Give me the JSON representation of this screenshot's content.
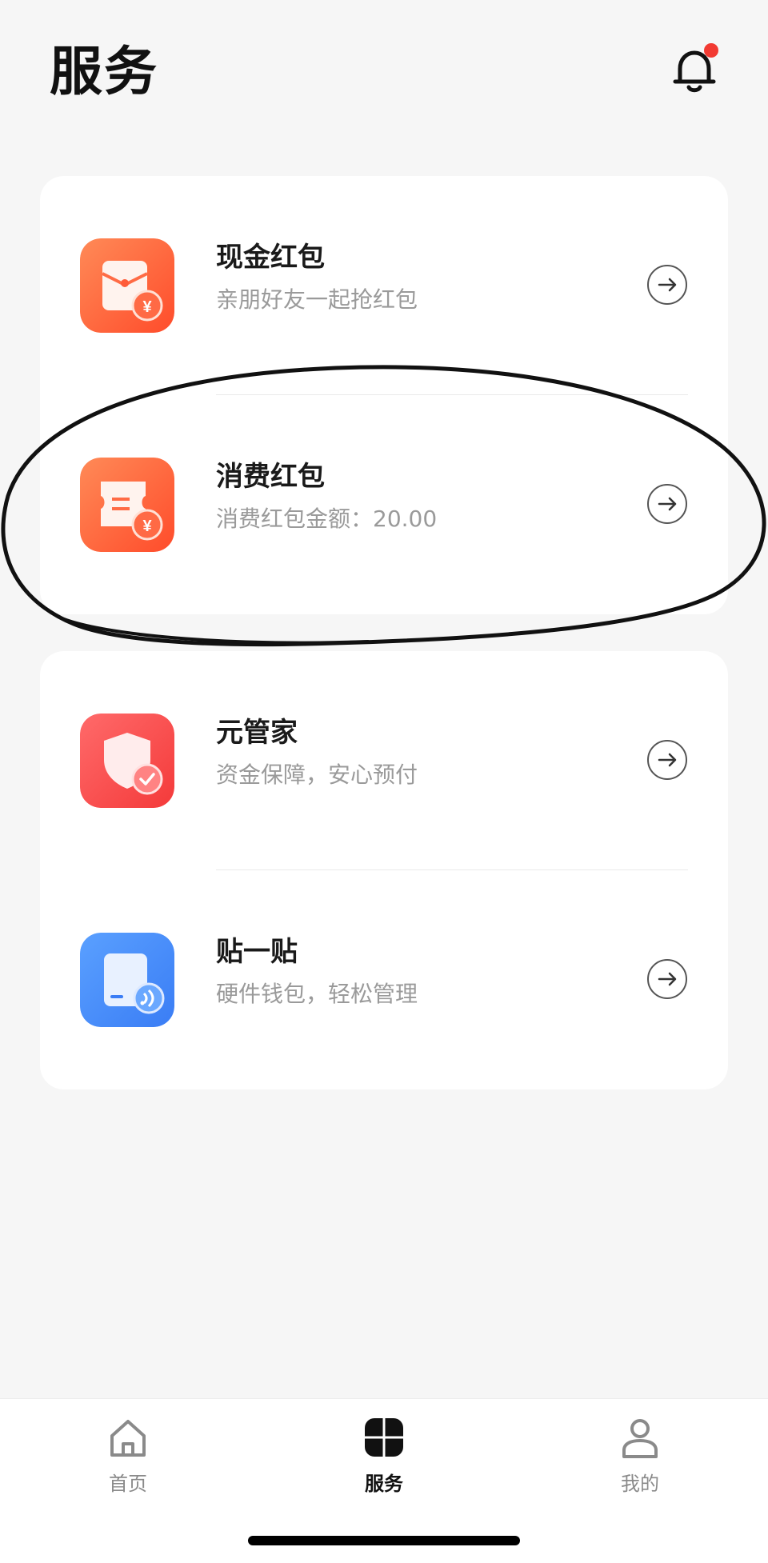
{
  "header": {
    "title": "服务",
    "notification_icon": "bell-icon",
    "has_unread": true
  },
  "colors": {
    "background": "#f6f6f6",
    "card": "#ffffff",
    "badge_red": "#f23a32",
    "orange_gradient_start": "#ff8a57",
    "orange_gradient_end": "#ff4c2b",
    "red_gradient_start": "#ff6a6a",
    "red_gradient_end": "#f43a3a",
    "blue_gradient_start": "#5aa0ff",
    "blue_gradient_end": "#3a7df5"
  },
  "services": {
    "group1": [
      {
        "name": "现金红包",
        "desc": "亲朋好友一起抢红包",
        "icon": "cash-red-envelope-icon"
      },
      {
        "name": "消费红包",
        "desc": "消费红包金额：20.00",
        "icon": "consumption-red-envelope-icon"
      }
    ],
    "group2": [
      {
        "name": "元管家",
        "desc": "资金保障，安心预付",
        "icon": "shield-check-icon"
      },
      {
        "name": "贴一贴",
        "desc": "硬件钱包，轻松管理",
        "icon": "nfc-wallet-icon"
      }
    ]
  },
  "tabbar": {
    "items": [
      {
        "label": "首页",
        "icon": "home-icon",
        "active": false
      },
      {
        "label": "服务",
        "icon": "four-leaf-icon",
        "active": true
      },
      {
        "label": "我的",
        "icon": "user-icon",
        "active": false
      }
    ]
  }
}
